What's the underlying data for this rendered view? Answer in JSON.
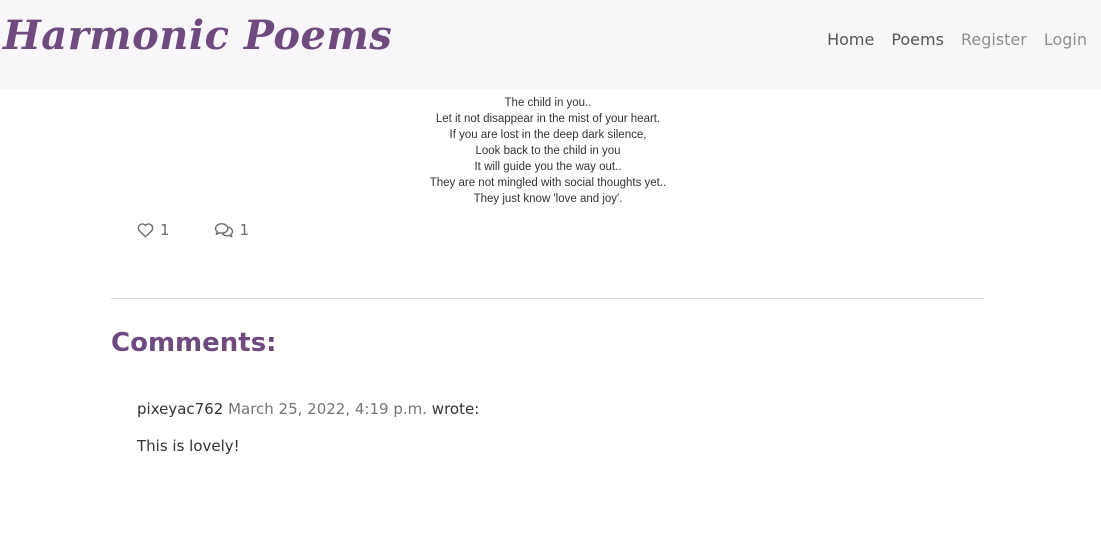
{
  "navbar": {
    "brand": "Harmonic Poems",
    "links": [
      {
        "label": "Home"
      },
      {
        "label": "Poems"
      },
      {
        "label": "Register"
      },
      {
        "label": "Login"
      }
    ]
  },
  "poem": {
    "lines": [
      "The child in you..",
      "Let it not disappear in the mist of your heart.",
      "If you are lost in the deep dark silence,",
      "Look back to the child in you",
      "It will guide you the way out..",
      "They are not mingled with social thoughts yet..",
      "They just know 'love and joy'."
    ]
  },
  "stats": {
    "likes": "1",
    "comments": "1"
  },
  "comments_section": {
    "heading": "Comments:",
    "items": [
      {
        "author": "pixeyac762",
        "date": "March 25, 2022, 4:19 p.m.",
        "suffix": "wrote:",
        "body": "This is lovely!"
      }
    ]
  },
  "colors": {
    "brand": "#6e4a7e",
    "navbar_bg": "#f8f6f9"
  },
  "icons": {
    "like": "heart-icon",
    "comment": "comments-icon"
  }
}
